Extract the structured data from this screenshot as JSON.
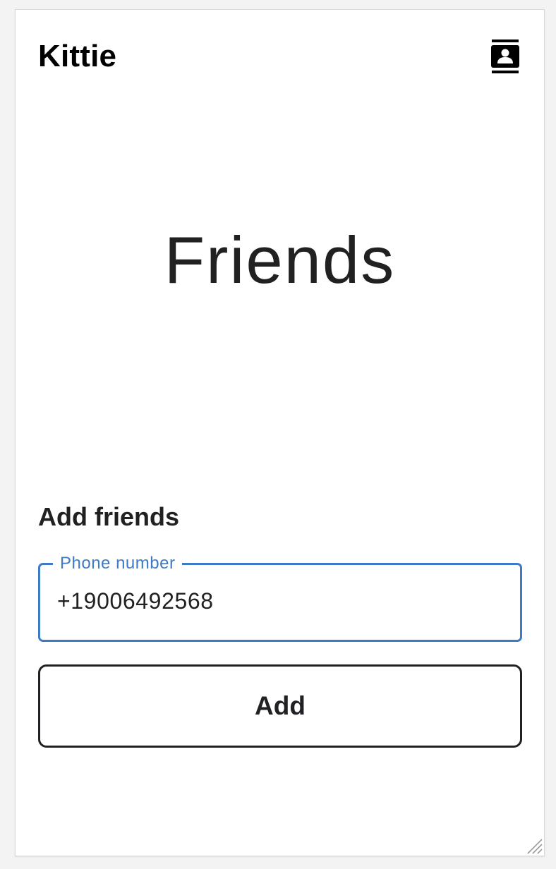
{
  "header": {
    "app_title": "Kittie",
    "contacts_icon": "contacts-icon"
  },
  "main": {
    "page_title": "Friends"
  },
  "add_friends": {
    "section_title": "Add friends",
    "phone_field": {
      "label": "Phone number",
      "value": "+19006492568"
    },
    "add_button_label": "Add"
  },
  "colors": {
    "accent": "#3f7ac6",
    "text": "#212121",
    "title": "#000000",
    "page_background": "#f3f3f3",
    "surface": "#ffffff"
  }
}
